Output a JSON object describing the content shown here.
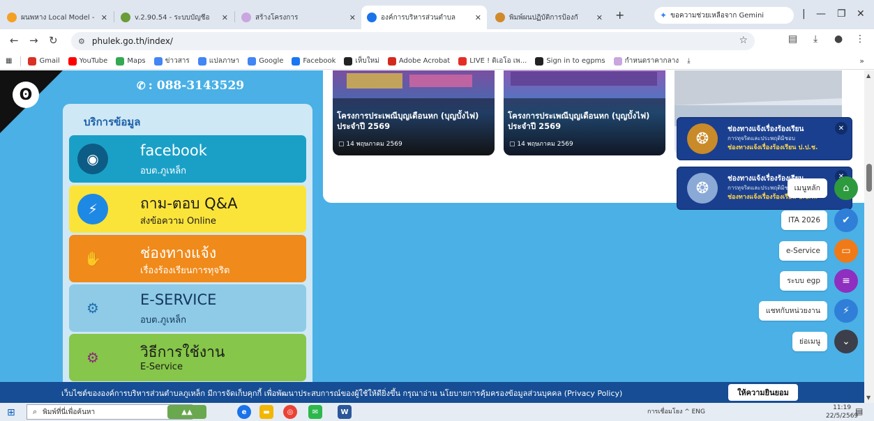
{
  "browser": {
    "tabs": [
      {
        "title": "ผนพหาง Local Model - ",
        "active": false,
        "favicon_color": "#f4a023"
      },
      {
        "title": "v.2.90.54 - ระบบบัญชีอ",
        "active": false,
        "favicon_color": "#6a9c3a"
      },
      {
        "title": "สร้างโครงการ",
        "active": false,
        "favicon_color": "#c9a6e0"
      },
      {
        "title": "องค์การบริหารส่วนตำบล",
        "active": true,
        "favicon_color": "#1a73e8"
      },
      {
        "title": "พิมพ์ผนปฏิบัติการป้องกั",
        "active": false,
        "favicon_color": "#d08a2a"
      }
    ],
    "new_tab": "+",
    "gemini_label": "ขอความช่วยเหลือจาก Gemini",
    "url": "phulek.go.th/index/",
    "bookmarks": [
      {
        "label": "Gmail",
        "icon": "gmail-icon",
        "color": "#d93025"
      },
      {
        "label": "YouTube",
        "icon": "youtube-icon",
        "color": "#ff0000"
      },
      {
        "label": "Maps",
        "icon": "maps-icon",
        "color": "#34a853"
      },
      {
        "label": "ข่าวสาร",
        "icon": "news-icon",
        "color": "#4285f4"
      },
      {
        "label": "แปลภาษา",
        "icon": "translate-icon",
        "color": "#4285f4"
      },
      {
        "label": "Google",
        "icon": "google-icon",
        "color": "#4285f4"
      },
      {
        "label": "Facebook",
        "icon": "facebook-icon",
        "color": "#1877f2"
      },
      {
        "label": "เห็บใหม่",
        "icon": "github-icon",
        "color": "#222222"
      },
      {
        "label": "Adobe Acrobat",
        "icon": "acrobat-icon",
        "color": "#d42a1e"
      },
      {
        "label": "LIVE ! ดิเอโอ เพ...",
        "icon": "live-icon",
        "color": "#e52d27"
      },
      {
        "label": "Sign in to egpms",
        "icon": "egpms-icon",
        "color": "#222222"
      },
      {
        "label": "กำหนดราคากลาง",
        "icon": "price-icon",
        "color": "#c9a6e0"
      }
    ],
    "bookmarks_more": "»"
  },
  "page": {
    "phone": ": 088-3143529",
    "panel_title": "บริการข้อมูล",
    "services": [
      {
        "line1": "facebook",
        "line2": "อบต.ภูเหล็ก",
        "bg": "#1aa0c7",
        "fg": "#ffffff",
        "icon": "facebook-logo-icon",
        "icon_bg": "#0d5c85",
        "glyph": "◉"
      },
      {
        "line1": "ถาม-ตอบ Q&A",
        "line2": "ส่งข้อความ Online",
        "bg": "#fbe43a",
        "fg": "#1a1a1a",
        "icon": "messenger-icon",
        "icon_bg": "#1e88e5",
        "glyph": "⚡"
      },
      {
        "line1": "ช่องทางแจ้ง",
        "line2": "เรื่องร้องเรียนการทุจริต",
        "bg": "#f08a1a",
        "fg": "#ffffff",
        "icon": "handshake-icon",
        "icon_bg": "#f08a1a",
        "glyph": "✋"
      },
      {
        "line1": "E-SERVICE",
        "line2": "อบต.ภูเหล็ก",
        "bg": "#8fcbe6",
        "fg": "#14365e",
        "icon": "eservice-icon",
        "icon_bg": "#8fcbe6",
        "glyph": "⚙"
      },
      {
        "line1": "วิธีการใช้งาน",
        "line2": "E-Service",
        "bg": "#86c64a",
        "fg": "#1a1a1a",
        "icon": "gears-icon",
        "icon_bg": "#86c64a",
        "glyph": "⚙"
      }
    ],
    "news": [
      {
        "title": "โครงการประเพณีบุญเดือนหก (บุญบั้งไฟ) ประจำปี 2569",
        "date": "14 พฤษภาคม 2569"
      },
      {
        "title": "โครงการประเพณีบุญเดือนหก (บุญบั้งไฟ) ประจำปี 2569",
        "date": "14 พฤษภาคม 2569"
      }
    ],
    "complaint_cards": [
      {
        "line1": "ช่องทางแจ้งเรื่องร้องเรียน",
        "line2": "การทุจริตและประพฤติมิชอบ",
        "line3": "ช่องทางแจ้งเรื่องร้องเรียน ป.ป.ช."
      },
      {
        "line1": "ช่องทางแจ้งเรื่องร้องเรียน",
        "line2": "การทุจริตและประพฤติมิชอบ",
        "line3": "ช่องทางแจ้งเรื่องร้องเรียน ป.ป.ท."
      }
    ],
    "floating_menu": [
      {
        "label": "เมนูหลัก",
        "icon": "home-icon",
        "color": "#2e9a3e",
        "glyph": "⌂"
      },
      {
        "label": "ITA 2026",
        "icon": "check-badge-icon",
        "color": "#2f7fd8",
        "glyph": "✔"
      },
      {
        "label": "e-Service",
        "icon": "chat-window-icon",
        "color": "#f07a17",
        "glyph": "▭"
      },
      {
        "label": "ระบบ egp",
        "icon": "list-icon",
        "color": "#8e2fbf",
        "glyph": "≡"
      },
      {
        "label": "แชทกับหน่วยงาน",
        "icon": "messenger-icon",
        "color": "#2f7fd8",
        "glyph": "⚡"
      },
      {
        "label": "ย่อเมนู",
        "icon": "chevron-down-icon",
        "color": "#3c3f4a",
        "glyph": "⌄"
      }
    ],
    "cookie": {
      "text": "เว็บไซต์ขององค์การบริหารส่วนตำบลภูเหล็ก มีการจัดเก็บคุกกี้ เพื่อพัฒนาประสบการณ์ของผู้ใช้ให้ดียิ่งขึ้น กรุณาอ่าน นโยบายการคุ้มครองข้อมูลส่วนบุคคล (Privacy Policy)",
      "accept": "ให้ความยินยอม"
    }
  },
  "taskbar": {
    "search_placeholder": "พิมพ์ที่นี่เพื่อค้นหา",
    "tray": "การเชื่อมโยง ^ ENG",
    "time": "11:19",
    "date": "22/5/2569"
  }
}
